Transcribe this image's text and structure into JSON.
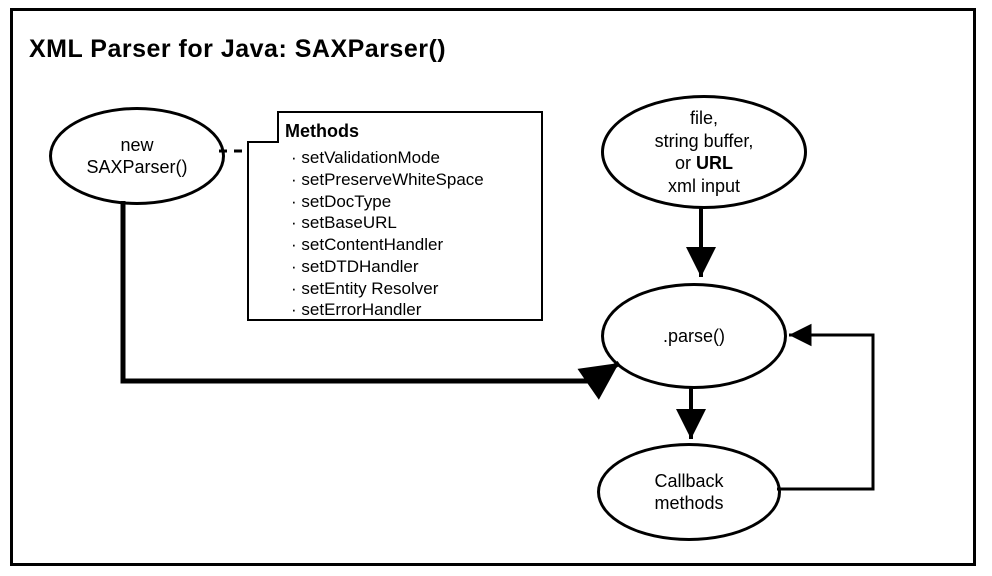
{
  "title": "XML Parser for Java: SAXParser()",
  "nodes": {
    "new_parser": {
      "line1": "new",
      "line2": "SAXParser()"
    },
    "xml_input": {
      "line1": "file,",
      "line2": "string buffer,",
      "line3_prefix": "or ",
      "line3_bold": "URL",
      "line4": "xml input"
    },
    "parse": {
      "label": ".parse()"
    },
    "callback": {
      "line1": "Callback",
      "line2": "methods"
    }
  },
  "note": {
    "heading": "Methods",
    "items": [
      "setValidationMode",
      "setPreserveWhiteSpace",
      "setDocType",
      "setBaseURL",
      "setContentHandler",
      "setDTDHandler",
      "setEntity Resolver",
      "setErrorHandler"
    ]
  }
}
